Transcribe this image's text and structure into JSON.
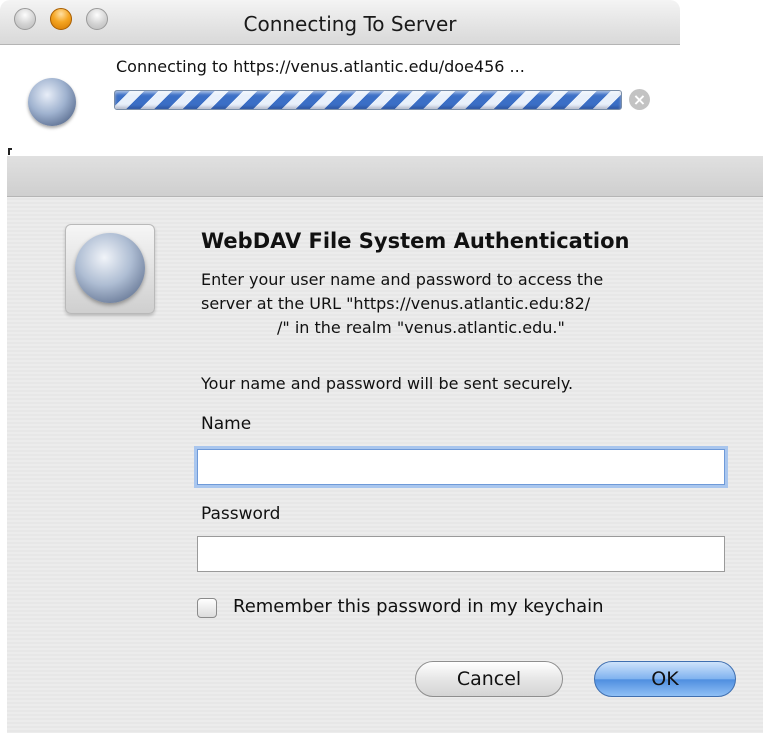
{
  "connecting_window": {
    "title": "Connecting To Server",
    "message": "Connecting to https://venus.atlantic.edu/doe456 ...",
    "stop_glyph": "×"
  },
  "auth_dialog": {
    "title": "WebDAV File System Authentication",
    "body_lines": [
      "Enter your user name and password to access the",
      "server at the URL \"https://venus.atlantic.edu:82/",
      "/\" in the realm \"venus.atlantic.edu.\""
    ],
    "secure_note": "Your name and password will be sent securely.",
    "name_label": "Name",
    "name_value": "",
    "password_label": "Password",
    "password_value": "",
    "remember_label": "Remember this password in my keychain",
    "remember_checked": false,
    "cancel_label": "Cancel",
    "ok_label": "OK"
  },
  "icons": {
    "window_close": "close-button-icon",
    "window_minimize": "minimize-button-icon",
    "window_zoom": "zoom-button-icon",
    "network_globe": "network-globe-icon",
    "stop": "stop-icon"
  },
  "colors": {
    "progress_stripe": "#3b6fc6",
    "default_button": "#6ea6ec",
    "focus_ring": "#a9c6ee"
  }
}
